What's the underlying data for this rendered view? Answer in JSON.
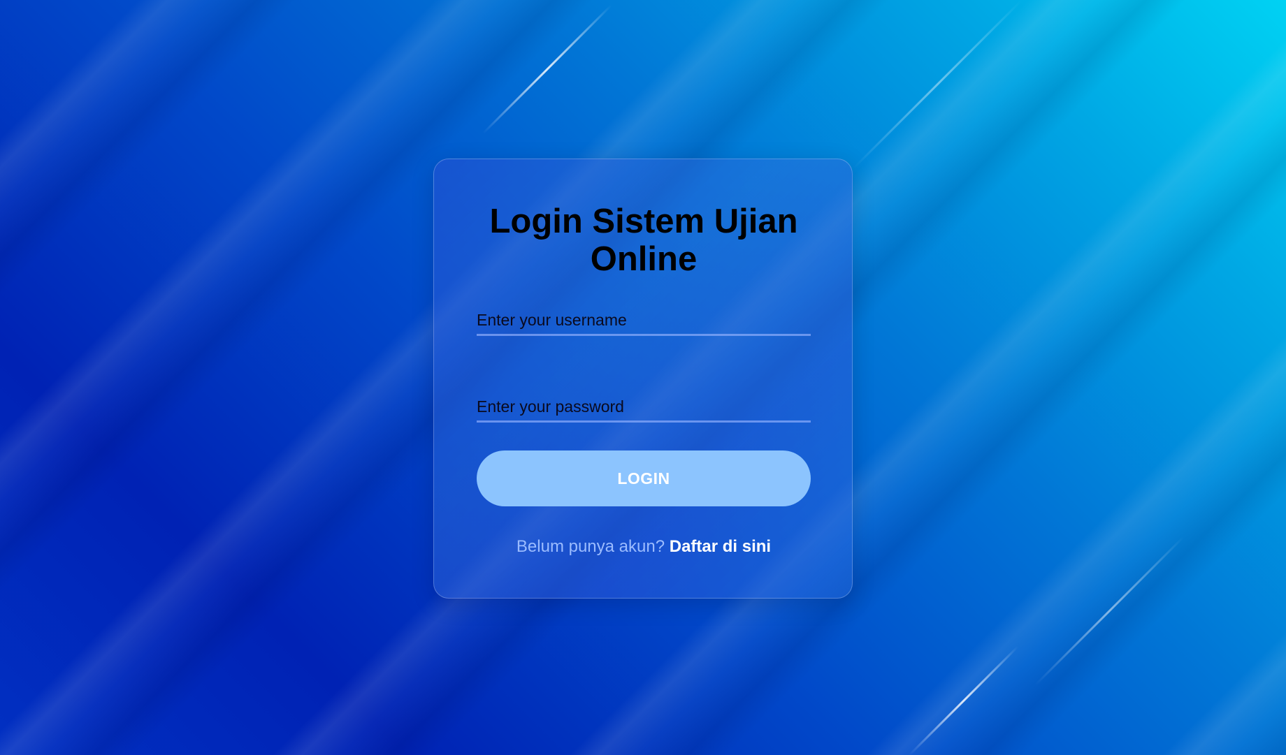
{
  "colors": {
    "background_start": "#00d2f3",
    "background_end": "#0022b4",
    "login_button": "#8cc4fe",
    "title_text": "#000000",
    "muted_text": "#9bbcff",
    "link_text": "#ffffff"
  },
  "login": {
    "title": "Login Sistem Ujian Online",
    "username_placeholder": "Enter your username",
    "password_placeholder": "Enter your password",
    "button_label": "LOGIN",
    "register_prompt": "Belum punya akun?",
    "register_link": "Daftar di sini"
  }
}
